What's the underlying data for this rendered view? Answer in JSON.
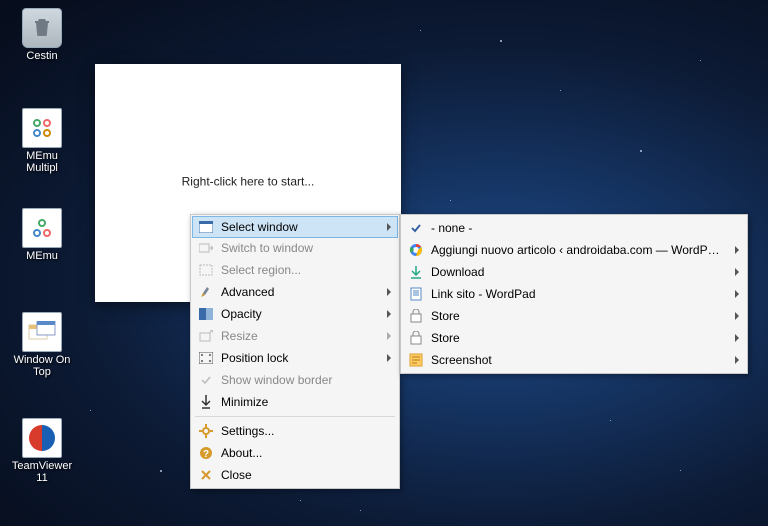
{
  "desktop": {
    "icons": [
      {
        "label": "Cestin"
      },
      {
        "label": "MEmu\nMultipl"
      },
      {
        "label": "MEmu"
      },
      {
        "label": "Window On\nTop"
      },
      {
        "label": "TeamViewer\n11"
      }
    ]
  },
  "appWindow": {
    "message": "Right-click here to start..."
  },
  "contextMenu": {
    "items": [
      {
        "label": "Select window",
        "selected": true,
        "hasSubmenu": true
      },
      {
        "label": "Switch to window",
        "disabled": true
      },
      {
        "label": "Select region...",
        "disabled": true
      },
      {
        "label": "Advanced",
        "hasSubmenu": true
      },
      {
        "label": "Opacity",
        "hasSubmenu": true
      },
      {
        "label": "Resize",
        "disabled": true,
        "hasSubmenu": true
      },
      {
        "label": "Position lock",
        "hasSubmenu": true
      },
      {
        "label": "Show window border",
        "disabled": true
      },
      {
        "label": "Minimize"
      },
      {
        "label": "Settings..."
      },
      {
        "label": "About..."
      },
      {
        "label": "Close"
      }
    ]
  },
  "submenu": {
    "items": [
      {
        "label": "- none -",
        "checked": true
      },
      {
        "label": "Aggiungi nuovo articolo ‹ androidaba.com — WordPress - ...",
        "hasSubmenu": true
      },
      {
        "label": "Download",
        "hasSubmenu": true
      },
      {
        "label": "Link sito - WordPad",
        "hasSubmenu": true
      },
      {
        "label": "Store",
        "hasSubmenu": true
      },
      {
        "label": "Store",
        "hasSubmenu": true
      },
      {
        "label": "Screenshot",
        "hasSubmenu": true
      }
    ]
  }
}
